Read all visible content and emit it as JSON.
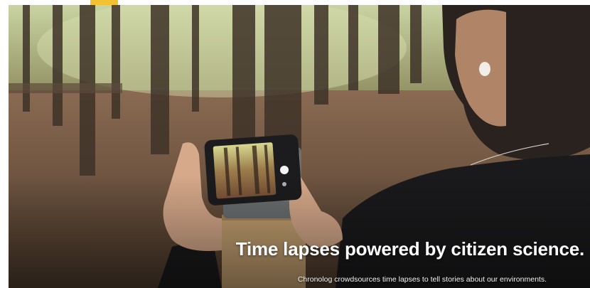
{
  "hero": {
    "headline": "Time lapses powered by citizen science.",
    "subheadline": "Chronolog crowdsources time lapses to tell stories about our environments.",
    "accent_color": "#f2c230",
    "background_image": "forest-photo-woman-phone-mount",
    "text_color": "#ffffff"
  }
}
